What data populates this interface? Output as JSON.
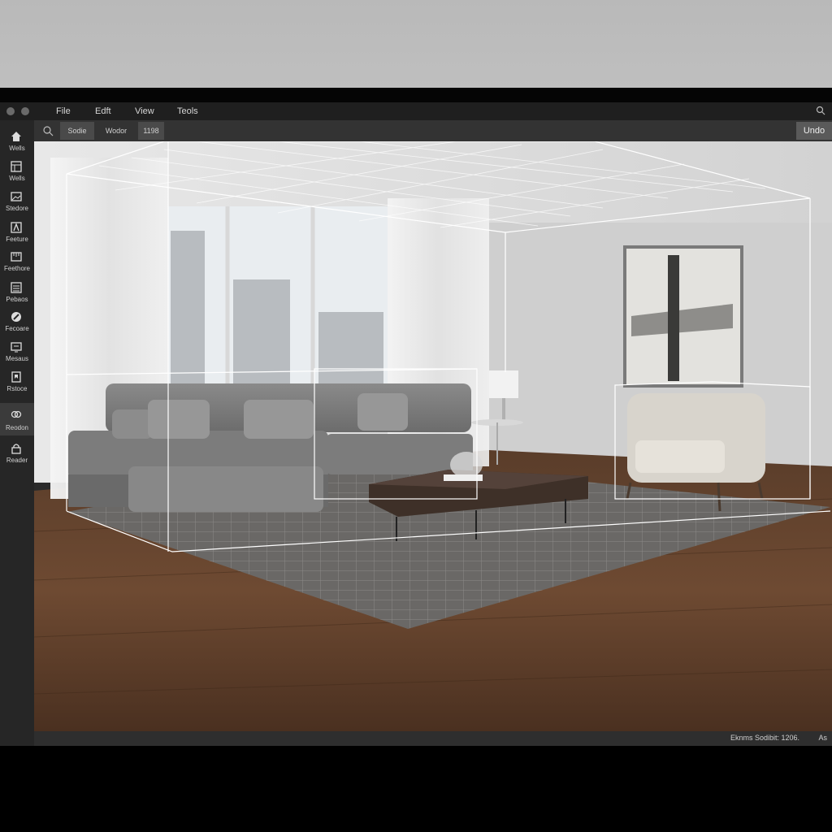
{
  "menubar": {
    "items": [
      "File",
      "Edft",
      "View",
      "Teols"
    ]
  },
  "toolbar": {
    "buttons": [
      "Sodie",
      "Wodor",
      "1198"
    ],
    "undo_label": "Undo"
  },
  "sidebar": {
    "items": [
      {
        "label": "Wells",
        "icon": "home-icon"
      },
      {
        "label": "Wells",
        "icon": "grid-panel-icon"
      },
      {
        "label": "Stedore",
        "icon": "image-frame-icon"
      },
      {
        "label": "Feeture",
        "icon": "text-icon"
      },
      {
        "label": "Feethore",
        "icon": "ruler-icon"
      },
      {
        "label": "Pebaos",
        "icon": "list-icon"
      },
      {
        "label": "Fecoare",
        "icon": "brush-icon"
      },
      {
        "label": "Mesaus",
        "icon": "monitor-icon"
      },
      {
        "label": "Rstoce",
        "icon": "bookmark-icon"
      },
      {
        "label": "Reodon",
        "icon": "link-icon"
      },
      {
        "label": "Reader",
        "icon": "lock-icon"
      }
    ],
    "active_index": 9
  },
  "statusbar": {
    "text": "Eknms Sodibit: 1206.",
    "extra": "As"
  },
  "colors": {
    "menubar_bg": "#1f1f1f",
    "toolbar_bg": "#333333",
    "sidebar_bg": "#262626",
    "undo_bg": "#5a5a5a",
    "wireframe": "#ffffff"
  }
}
